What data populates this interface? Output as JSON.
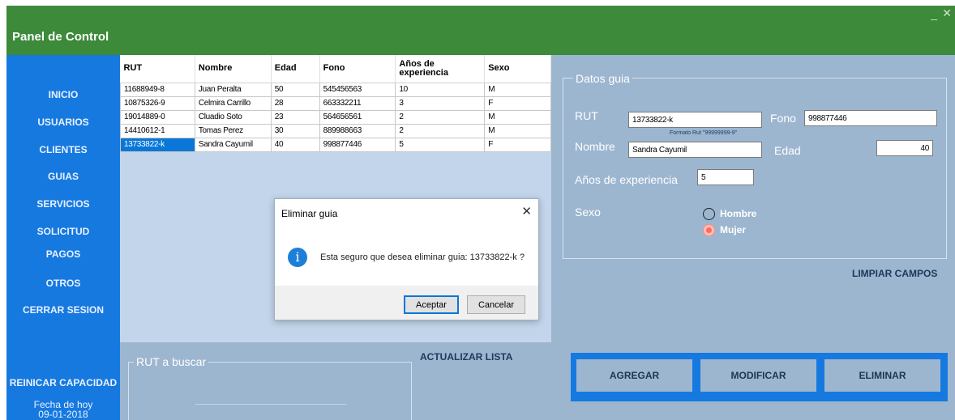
{
  "window": {
    "title": "Panel de Control",
    "minimize_glyph": "_",
    "close_glyph": "✕"
  },
  "sidebar": {
    "items": [
      {
        "label": "INICIO"
      },
      {
        "label": "USUARIOS"
      },
      {
        "label": "CLIENTES"
      },
      {
        "label": "GUIAS"
      },
      {
        "label": "SERVICIOS"
      },
      {
        "label": "SOLICITUD"
      },
      {
        "label": "PAGOS"
      },
      {
        "label": "OTROS"
      },
      {
        "label": "CERRAR SESION"
      }
    ],
    "reset_capacity": "REINICAR CAPACIDAD",
    "date_label": "Fecha de hoy",
    "date_value": "09-01-2018"
  },
  "grid": {
    "columns": [
      "RUT",
      "Nombre",
      "Edad",
      "Fono",
      "Años de experiencia",
      "Sexo"
    ],
    "rows": [
      [
        "11688949-8",
        "Juan Peralta",
        "50",
        "545456563",
        "10",
        "M"
      ],
      [
        "10875326-9",
        "Celmira Carrillo",
        "28",
        "663332211",
        "3",
        "F"
      ],
      [
        "19014889-0",
        "Cluadio Soto",
        "23",
        "564656561",
        "2",
        "M"
      ],
      [
        "14410612-1",
        "Tomas Perez",
        "30",
        "889988663",
        "2",
        "M"
      ],
      [
        "13733822-k",
        "Sandra Cayumil",
        "40",
        "998877446",
        "5",
        "F"
      ]
    ],
    "selected_row": 4
  },
  "dialog": {
    "title": "Eliminar guia",
    "message": "Esta seguro que desea eliminar guia: 13733822-k ?",
    "icon": "info-icon",
    "accept_label": "Aceptar",
    "cancel_label": "Cancelar"
  },
  "form": {
    "group_title": "Datos guia",
    "rut_label": "RUT",
    "rut_value": "13733822-k",
    "rut_hint": "Formato Rut \"99999999-9\"",
    "fono_label": "Fono",
    "fono_value": "998877446",
    "nombre_label": "Nombre",
    "nombre_value": "Sandra Cayumil",
    "edad_label": "Edad",
    "edad_value": "40",
    "exp_label": "Años de experiencia",
    "exp_value": "5",
    "sexo_label": "Sexo",
    "sexo_options": [
      "Hombre",
      "Mujer"
    ],
    "sexo_selected": "Mujer",
    "clear_label": "LIMPIAR CAMPOS"
  },
  "search": {
    "group_title": "RUT a buscar",
    "value": "",
    "refresh_label": "ACTUALIZAR LISTA"
  },
  "actions": {
    "add_label": "AGREGAR",
    "modify_label": "MODIFICAR",
    "delete_label": "ELIMINAR"
  },
  "colors": {
    "title_bar": "#3c8a3a",
    "sidebar": "#1679e0",
    "panel": "#9cb6d0",
    "selection": "#0a77d8"
  }
}
